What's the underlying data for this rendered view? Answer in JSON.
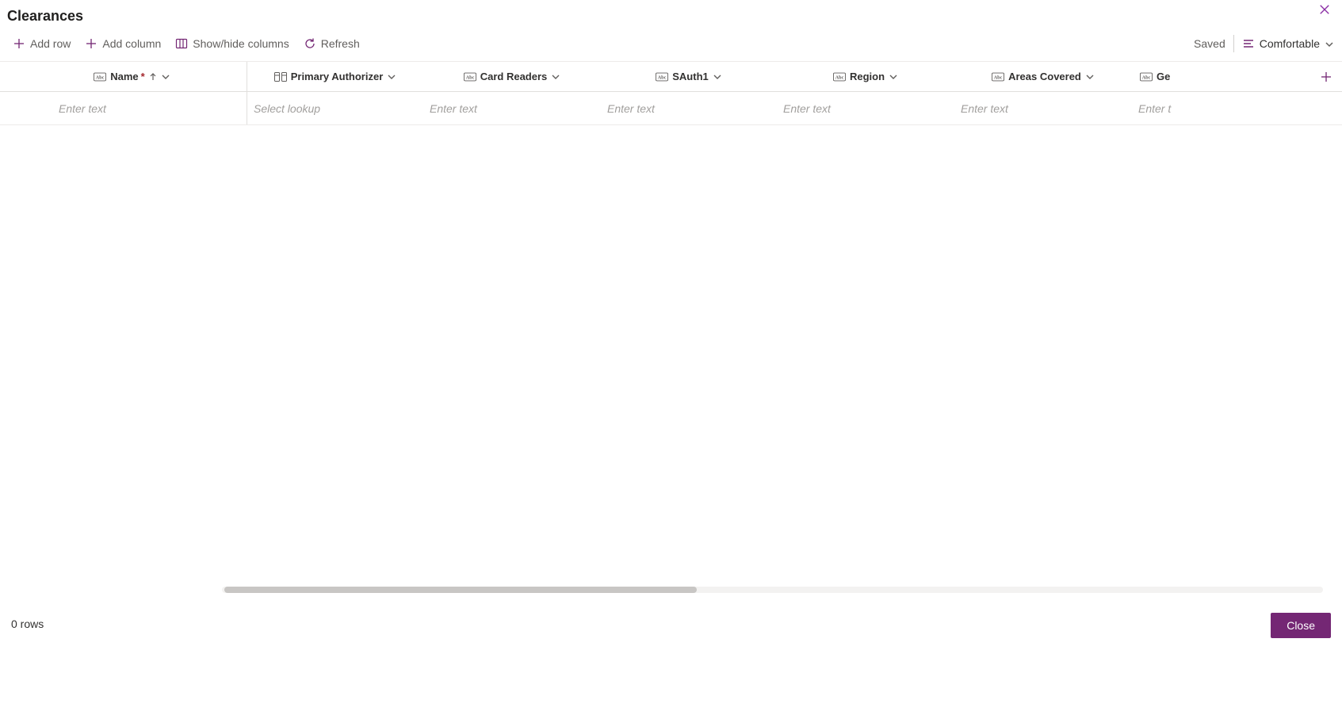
{
  "title": "Clearances",
  "toolbar": {
    "add_row": "Add row",
    "add_column": "Add column",
    "show_hide": "Show/hide columns",
    "refresh": "Refresh"
  },
  "status": {
    "saved": "Saved",
    "density": "Comfortable"
  },
  "columns": {
    "name": "Name",
    "primary_authorizer": "Primary Authorizer",
    "card_readers": "Card Readers",
    "sauth1": "SAuth1",
    "region": "Region",
    "areas_covered": "Areas Covered",
    "ge": "Ge"
  },
  "placeholders": {
    "enter_text": "Enter text",
    "select_lookup": "Select lookup",
    "enter_t": "Enter t"
  },
  "footer": {
    "rows": "0 rows",
    "close": "Close"
  }
}
